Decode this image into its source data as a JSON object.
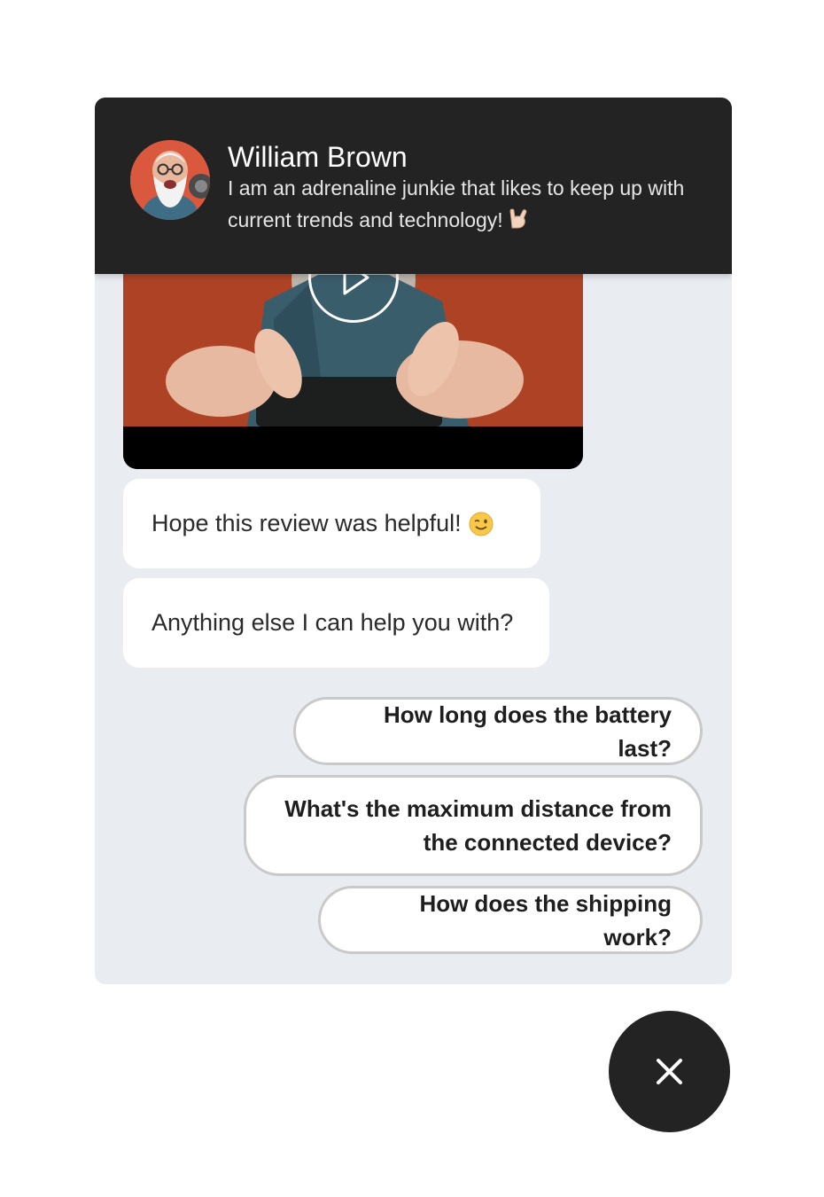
{
  "header": {
    "agent_name": "William Brown",
    "agent_bio": "I am an adrenaline junkie that likes to keep up with current trends and technology!",
    "bio_emoji_icon": "rock-on-hand-icon",
    "avatar_icon": "avatar-photo"
  },
  "video": {
    "thumbnail_icon": "video-thumbnail",
    "play_icon": "play-icon"
  },
  "messages": [
    {
      "text": "Hope this review was helpful!",
      "emoji_icon": "wink-emoji-icon"
    },
    {
      "text": "Anything else I can help you with?"
    }
  ],
  "quick_replies": [
    {
      "label": "How long does the battery last?"
    },
    {
      "label": "What's the maximum distance from the connected device?"
    },
    {
      "label": "How does the shipping work?"
    }
  ],
  "close_button": {
    "icon": "close-icon"
  },
  "colors": {
    "header_bg": "#232323",
    "chat_bg": "#e9ecf1",
    "bubble_bg": "#ffffff",
    "quick_reply_border": "#c9c9c9",
    "video_bg": "#c34a2a"
  }
}
